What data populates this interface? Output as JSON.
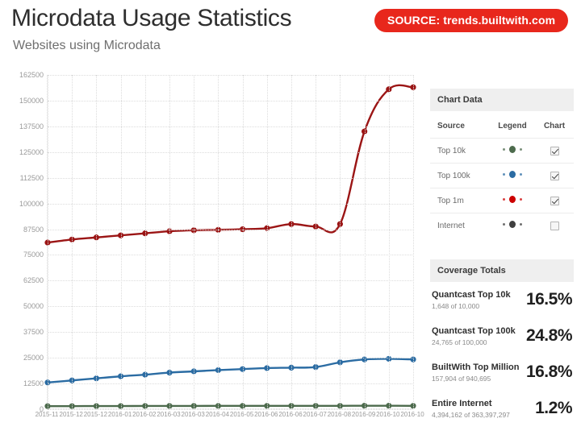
{
  "header": {
    "title": "Microdata Usage Statistics",
    "subtitle": "Websites using Microdata",
    "source_badge": "SOURCE: trends.builtwith.com"
  },
  "chart_data": {
    "type": "line",
    "title": "Microdata Usage Statistics",
    "subtitle": "Websites using Microdata",
    "xlabel": "",
    "ylabel": "",
    "ylim": [
      0,
      162500
    ],
    "ytick_step": 12500,
    "yticks": [
      "0",
      "12500",
      "25000",
      "37500",
      "50000",
      "62500",
      "75000",
      "87500",
      "100000",
      "112500",
      "125000",
      "137500",
      "150000",
      "162500"
    ],
    "grid": true,
    "legend_position": "right-panel",
    "categories": [
      "2015-11",
      "2015-12",
      "2015-12",
      "2016-01",
      "2016-02",
      "2016-03",
      "2016-03",
      "2016-04",
      "2016-05",
      "2016-06",
      "2016-06",
      "2016-07",
      "2016-08",
      "2016-09",
      "2016-10",
      "2016-10"
    ],
    "series": [
      {
        "name": "Top 1m",
        "color": "#9b1515",
        "values": [
          81000,
          82500,
          83500,
          84500,
          85500,
          86500,
          87000,
          87200,
          87500,
          88000,
          90000,
          88800,
          90000,
          135000,
          155500,
          156500
        ]
      },
      {
        "name": "Top 100k",
        "color": "#2b6ca3",
        "values": [
          13000,
          14000,
          15000,
          16000,
          16800,
          17800,
          18400,
          19000,
          19500,
          20000,
          20200,
          20500,
          22800,
          24200,
          24500,
          24200
        ]
      },
      {
        "name": "Top 10k",
        "color": "#4d6b4d",
        "values": [
          1500,
          1500,
          1550,
          1550,
          1580,
          1600,
          1600,
          1620,
          1620,
          1640,
          1640,
          1640,
          1648,
          1700,
          1700,
          1648
        ]
      }
    ]
  },
  "chart_data_panel": {
    "title": "Chart Data",
    "columns": [
      "Source",
      "Legend",
      "Chart"
    ],
    "rows": [
      {
        "source": "Top 10k",
        "color": "#4d6b4d",
        "checked": true
      },
      {
        "source": "Top 100k",
        "color": "#2b6ca3",
        "checked": true
      },
      {
        "source": "Top 1m",
        "color": "#cc0000",
        "checked": true
      },
      {
        "source": "Internet",
        "color": "#3f3f3f",
        "checked": false
      }
    ]
  },
  "coverage_totals": {
    "title": "Coverage Totals",
    "rows": [
      {
        "name": "Quantcast Top 10k",
        "sub": "1,648 of 10,000",
        "pct": "16.5%"
      },
      {
        "name": "Quantcast Top 100k",
        "sub": "24,765 of 100,000",
        "pct": "24.8%"
      },
      {
        "name": "BuiltWith Top Million",
        "sub": "157,904 of 940,695",
        "pct": "16.8%"
      },
      {
        "name": "Entire Internet",
        "sub": "4,394,162 of 363,397,297",
        "pct": "1.2%"
      }
    ]
  }
}
